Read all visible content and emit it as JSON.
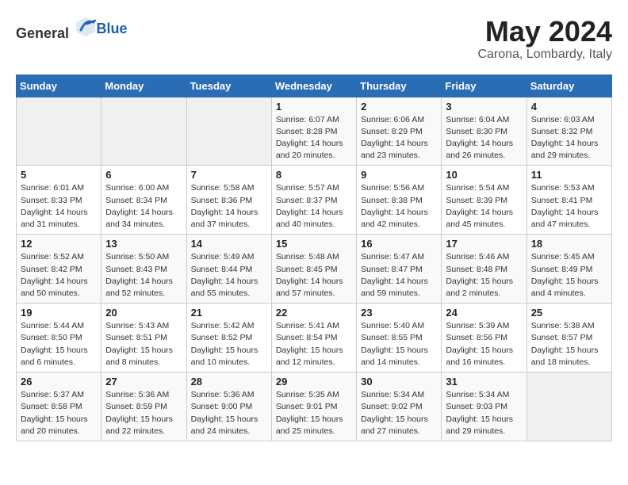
{
  "header": {
    "logo_general": "General",
    "logo_blue": "Blue",
    "month": "May 2024",
    "location": "Carona, Lombardy, Italy"
  },
  "weekdays": [
    "Sunday",
    "Monday",
    "Tuesday",
    "Wednesday",
    "Thursday",
    "Friday",
    "Saturday"
  ],
  "weeks": [
    [
      {
        "day": "",
        "content": ""
      },
      {
        "day": "",
        "content": ""
      },
      {
        "day": "",
        "content": ""
      },
      {
        "day": "1",
        "content": "Sunrise: 6:07 AM\nSunset: 8:28 PM\nDaylight: 14 hours and 20 minutes."
      },
      {
        "day": "2",
        "content": "Sunrise: 6:06 AM\nSunset: 8:29 PM\nDaylight: 14 hours and 23 minutes."
      },
      {
        "day": "3",
        "content": "Sunrise: 6:04 AM\nSunset: 8:30 PM\nDaylight: 14 hours and 26 minutes."
      },
      {
        "day": "4",
        "content": "Sunrise: 6:03 AM\nSunset: 8:32 PM\nDaylight: 14 hours and 29 minutes."
      }
    ],
    [
      {
        "day": "5",
        "content": "Sunrise: 6:01 AM\nSunset: 8:33 PM\nDaylight: 14 hours and 31 minutes."
      },
      {
        "day": "6",
        "content": "Sunrise: 6:00 AM\nSunset: 8:34 PM\nDaylight: 14 hours and 34 minutes."
      },
      {
        "day": "7",
        "content": "Sunrise: 5:58 AM\nSunset: 8:36 PM\nDaylight: 14 hours and 37 minutes."
      },
      {
        "day": "8",
        "content": "Sunrise: 5:57 AM\nSunset: 8:37 PM\nDaylight: 14 hours and 40 minutes."
      },
      {
        "day": "9",
        "content": "Sunrise: 5:56 AM\nSunset: 8:38 PM\nDaylight: 14 hours and 42 minutes."
      },
      {
        "day": "10",
        "content": "Sunrise: 5:54 AM\nSunset: 8:39 PM\nDaylight: 14 hours and 45 minutes."
      },
      {
        "day": "11",
        "content": "Sunrise: 5:53 AM\nSunset: 8:41 PM\nDaylight: 14 hours and 47 minutes."
      }
    ],
    [
      {
        "day": "12",
        "content": "Sunrise: 5:52 AM\nSunset: 8:42 PM\nDaylight: 14 hours and 50 minutes."
      },
      {
        "day": "13",
        "content": "Sunrise: 5:50 AM\nSunset: 8:43 PM\nDaylight: 14 hours and 52 minutes."
      },
      {
        "day": "14",
        "content": "Sunrise: 5:49 AM\nSunset: 8:44 PM\nDaylight: 14 hours and 55 minutes."
      },
      {
        "day": "15",
        "content": "Sunrise: 5:48 AM\nSunset: 8:45 PM\nDaylight: 14 hours and 57 minutes."
      },
      {
        "day": "16",
        "content": "Sunrise: 5:47 AM\nSunset: 8:47 PM\nDaylight: 14 hours and 59 minutes."
      },
      {
        "day": "17",
        "content": "Sunrise: 5:46 AM\nSunset: 8:48 PM\nDaylight: 15 hours and 2 minutes."
      },
      {
        "day": "18",
        "content": "Sunrise: 5:45 AM\nSunset: 8:49 PM\nDaylight: 15 hours and 4 minutes."
      }
    ],
    [
      {
        "day": "19",
        "content": "Sunrise: 5:44 AM\nSunset: 8:50 PM\nDaylight: 15 hours and 6 minutes."
      },
      {
        "day": "20",
        "content": "Sunrise: 5:43 AM\nSunset: 8:51 PM\nDaylight: 15 hours and 8 minutes."
      },
      {
        "day": "21",
        "content": "Sunrise: 5:42 AM\nSunset: 8:52 PM\nDaylight: 15 hours and 10 minutes."
      },
      {
        "day": "22",
        "content": "Sunrise: 5:41 AM\nSunset: 8:54 PM\nDaylight: 15 hours and 12 minutes."
      },
      {
        "day": "23",
        "content": "Sunrise: 5:40 AM\nSunset: 8:55 PM\nDaylight: 15 hours and 14 minutes."
      },
      {
        "day": "24",
        "content": "Sunrise: 5:39 AM\nSunset: 8:56 PM\nDaylight: 15 hours and 16 minutes."
      },
      {
        "day": "25",
        "content": "Sunrise: 5:38 AM\nSunset: 8:57 PM\nDaylight: 15 hours and 18 minutes."
      }
    ],
    [
      {
        "day": "26",
        "content": "Sunrise: 5:37 AM\nSunset: 8:58 PM\nDaylight: 15 hours and 20 minutes."
      },
      {
        "day": "27",
        "content": "Sunrise: 5:36 AM\nSunset: 8:59 PM\nDaylight: 15 hours and 22 minutes."
      },
      {
        "day": "28",
        "content": "Sunrise: 5:36 AM\nSunset: 9:00 PM\nDaylight: 15 hours and 24 minutes."
      },
      {
        "day": "29",
        "content": "Sunrise: 5:35 AM\nSunset: 9:01 PM\nDaylight: 15 hours and 25 minutes."
      },
      {
        "day": "30",
        "content": "Sunrise: 5:34 AM\nSunset: 9:02 PM\nDaylight: 15 hours and 27 minutes."
      },
      {
        "day": "31",
        "content": "Sunrise: 5:34 AM\nSunset: 9:03 PM\nDaylight: 15 hours and 29 minutes."
      },
      {
        "day": "",
        "content": ""
      }
    ]
  ]
}
